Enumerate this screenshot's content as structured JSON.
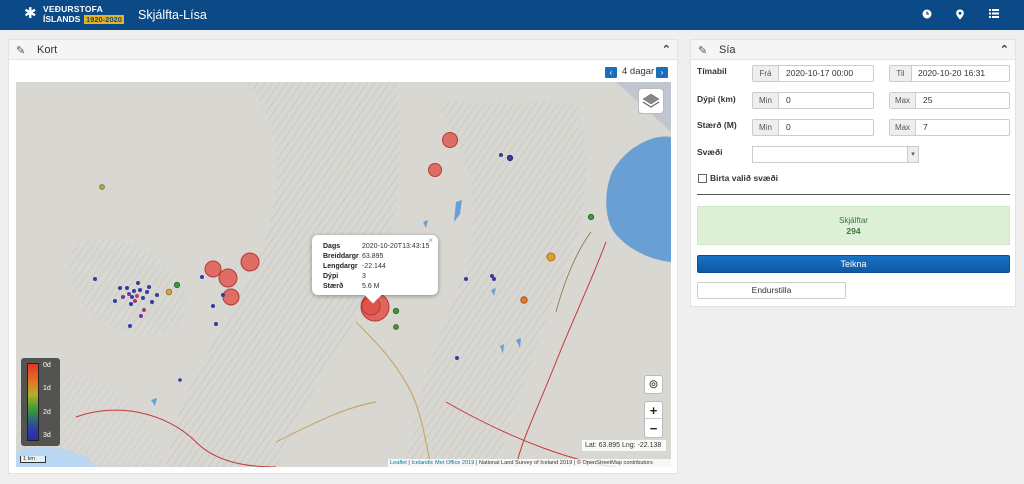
{
  "header": {
    "logo_line1": "VEÐURSTOFA",
    "logo_line2": "ÍSLANDS",
    "logo_years": "1920-2020",
    "app_title": "Skjálfta-Lísa",
    "icons": [
      "clock-icon",
      "map-pin-icon",
      "list-icon"
    ]
  },
  "map_panel": {
    "title": "Kort",
    "days_label": "4 dagar",
    "popup": {
      "rows": [
        {
          "key": "Dags",
          "value": "2020-10-20T13:43:15"
        },
        {
          "key": "Breiddargr",
          "value": "63.895"
        },
        {
          "key": "Lengdargr",
          "value": "-22.144"
        },
        {
          "key": "Dýpi",
          "value": "3"
        },
        {
          "key": "Stærð",
          "value": "5.6 M"
        }
      ]
    },
    "legend": [
      "0d",
      "1d",
      "2d",
      "3d"
    ],
    "coords": "Lat: 63.895 Lng: -22.138",
    "scale": "1 km",
    "attribution": {
      "leaflet": "Leaflet",
      "imo": "Icelandic Met Office 2019",
      "rest": "| National Land Survey of Iceland 2019 | © OpenStreetMap contributors"
    },
    "zoom_in": "+",
    "zoom_out": "−"
  },
  "filter_panel": {
    "title": "Sía",
    "time_label": "Tímabil",
    "from_addon": "Frá",
    "from_value": "2020-10-17 00:00",
    "to_addon": "Til",
    "to_value": "2020-10-20 16:31",
    "depth_label": "Dýpi (km)",
    "depth_min_addon": "Min",
    "depth_min": "0",
    "depth_max_addon": "Max",
    "depth_max": "25",
    "size_label": "Stærð (M)",
    "size_min_addon": "Min",
    "size_min": "0",
    "size_max_addon": "Max",
    "size_max": "7",
    "region_label": "Svæði",
    "show_region_label": "Birta valið svæði",
    "count_title": "Skjálftar",
    "count_value": "294",
    "draw_button": "Teikna",
    "reset_button": "Endurstilla"
  },
  "colors": {
    "header_bg": "#0b4a87",
    "primary_button": "#0d5aa5",
    "success_bg": "#dff0d8"
  }
}
